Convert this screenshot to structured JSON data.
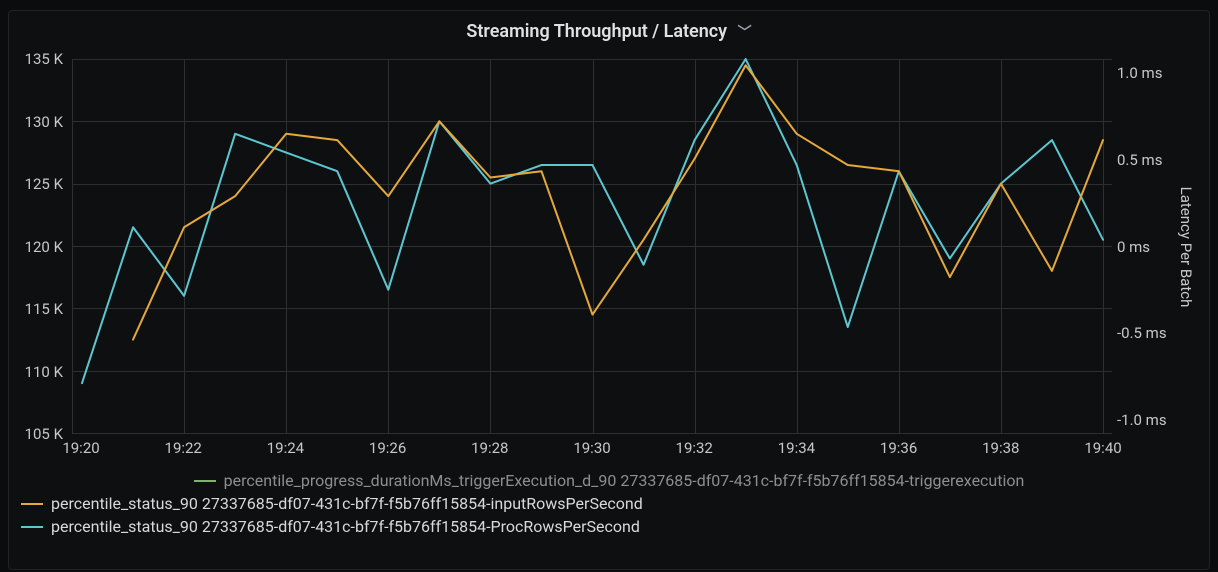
{
  "panel": {
    "title": "Streaming Throughput / Latency"
  },
  "axes": {
    "left_ticks": [
      "135 K",
      "130 K",
      "125 K",
      "120 K",
      "115 K",
      "110 K",
      "105 K"
    ],
    "right_ticks": [
      "1.0 ms",
      "0.5 ms",
      "0 ms",
      "-0.5 ms",
      "-1.0 ms"
    ],
    "x_ticks": [
      "19:20",
      "19:22",
      "19:24",
      "19:26",
      "19:28",
      "19:30",
      "19:32",
      "19:34",
      "19:36",
      "19:38",
      "19:40"
    ],
    "right_title": "Latency Per Batch"
  },
  "legend": {
    "trigger": "percentile_progress_durationMs_triggerExecution_d_90 27337685-df07-431c-bf7f-f5b76ff15854-triggerexecution",
    "input": "percentile_status_90 27337685-df07-431c-bf7f-f5b76ff15854-inputRowsPerSecond",
    "proc": "percentile_status_90 27337685-df07-431c-bf7f-f5b76ff15854-ProcRowsPerSecond"
  },
  "colors": {
    "trigger": "#7eb26d",
    "input": "#e5a83b",
    "proc": "#5cc7d1"
  },
  "chart_data": {
    "type": "line",
    "title": "Streaming Throughput / Latency",
    "x": [
      "19:20",
      "19:21",
      "19:22",
      "19:23",
      "19:24",
      "19:25",
      "19:26",
      "19:27",
      "19:28",
      "19:29",
      "19:30",
      "19:31",
      "19:32",
      "19:33",
      "19:34",
      "19:35",
      "19:36",
      "19:37",
      "19:38",
      "19:39",
      "19:40"
    ],
    "y_left": {
      "label": "",
      "min": 105000,
      "max": 135000
    },
    "y_right": {
      "label": "Latency Per Batch",
      "min": -1.0,
      "max": 1.0,
      "unit": "ms"
    },
    "series": [
      {
        "name": "percentile_status_90 27337685-df07-431c-bf7f-f5b76ff15854-inputRowsPerSecond",
        "axis": "left",
        "color": "#e5a83b",
        "values": [
          null,
          112500,
          121500,
          124000,
          129000,
          128500,
          124000,
          130000,
          125500,
          126000,
          114500,
          120500,
          127000,
          134500,
          129000,
          126500,
          126000,
          117500,
          125000,
          118000,
          128500
        ]
      },
      {
        "name": "percentile_status_90 27337685-df07-431c-bf7f-f5b76ff15854-ProcRowsPerSecond",
        "axis": "left",
        "color": "#5cc7d1",
        "values": [
          109000,
          121500,
          116000,
          129000,
          127500,
          126000,
          116500,
          130000,
          125000,
          126500,
          126500,
          118500,
          128500,
          135000,
          126500,
          113500,
          126000,
          119000,
          125000,
          128500,
          120500
        ]
      },
      {
        "name": "percentile_progress_durationMs_triggerExecution_d_90 27337685-df07-431c-bf7f-f5b76ff15854-triggerexecution",
        "axis": "right",
        "color": "#7eb26d",
        "values": []
      }
    ]
  }
}
